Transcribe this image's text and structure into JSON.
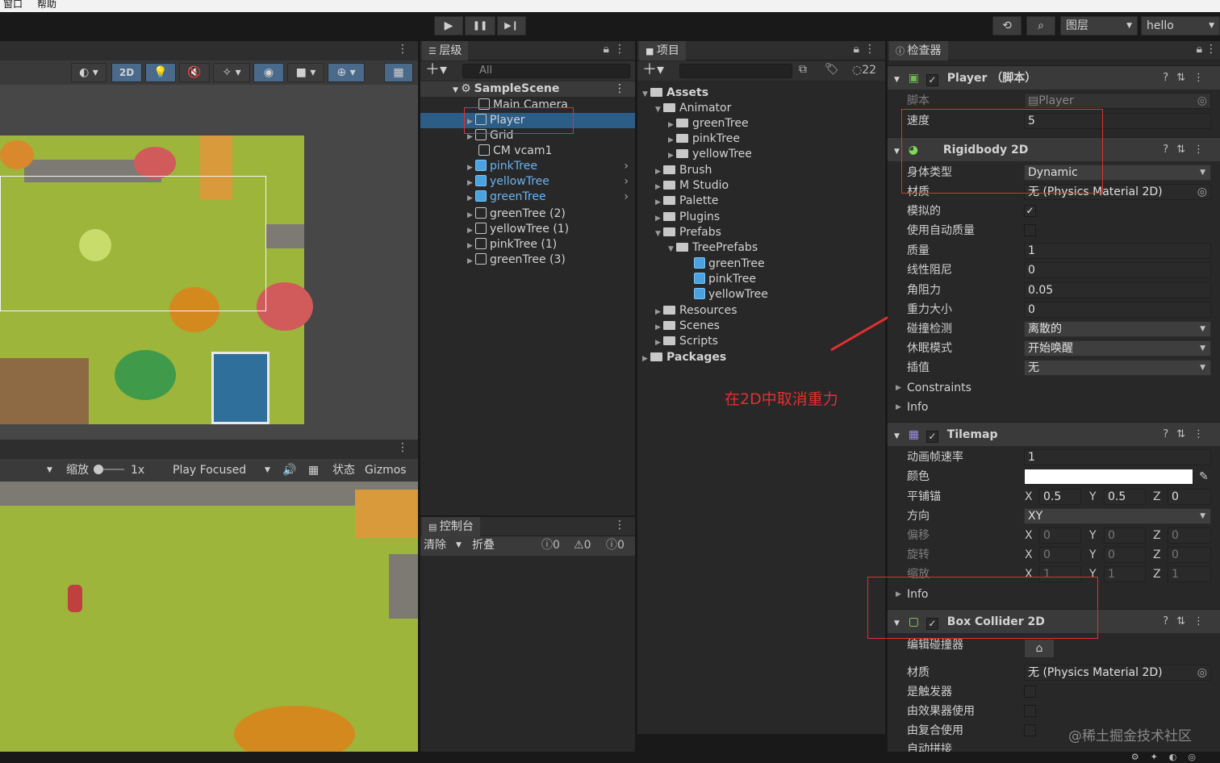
{
  "menubar": {
    "items": [
      "窗口",
      "帮助"
    ]
  },
  "toolbar": {
    "play": "▶",
    "pause": "❚❚",
    "step": "▶❙",
    "history": "⟲",
    "search": "⌕",
    "layers": "图层",
    "layout": "hello"
  },
  "scene": {
    "toggle_2d": "2D"
  },
  "game": {
    "scale_label": "缩放",
    "scale_value": "1x",
    "play_mode": "Play Focused",
    "stats": "状态",
    "gizmos": "Gizmos"
  },
  "hierarchy": {
    "tab": "层级",
    "search_placeholder": "All",
    "scene": "SampleScene",
    "items": [
      {
        "label": "Main Camera",
        "prefab": false
      },
      {
        "label": "Player",
        "prefab": false,
        "selected": true
      },
      {
        "label": "Grid",
        "prefab": false
      },
      {
        "label": "CM vcam1",
        "prefab": false
      },
      {
        "label": "pinkTree",
        "prefab": true
      },
      {
        "label": "yellowTree",
        "prefab": true
      },
      {
        "label": "greenTree",
        "prefab": true
      },
      {
        "label": "greenTree (2)",
        "prefab": false
      },
      {
        "label": "yellowTree (1)",
        "prefab": false
      },
      {
        "label": "pinkTree (1)",
        "prefab": false
      },
      {
        "label": "greenTree (3)",
        "prefab": false
      }
    ]
  },
  "console": {
    "tab": "控制台",
    "clear": "清除",
    "collapse": "折叠",
    "log_count": "0",
    "warn_count": "0",
    "error_count": "0"
  },
  "project": {
    "tab": "项目",
    "hidden_count": "22",
    "tree": [
      {
        "label": "Assets",
        "bold": true
      },
      {
        "label": "Animator"
      },
      {
        "label": "greenTree"
      },
      {
        "label": "pinkTree"
      },
      {
        "label": "yellowTree"
      },
      {
        "label": "Brush"
      },
      {
        "label": "M Studio"
      },
      {
        "label": "Palette"
      },
      {
        "label": "Plugins"
      },
      {
        "label": "Prefabs"
      },
      {
        "label": "TreePrefabs"
      },
      {
        "label": "greenTree"
      },
      {
        "label": "pinkTree"
      },
      {
        "label": "yellowTree"
      },
      {
        "label": "Resources"
      },
      {
        "label": "Scenes"
      },
      {
        "label": "Scripts"
      },
      {
        "label": "Packages",
        "bold": true
      }
    ]
  },
  "annotation": {
    "text": "在2D中取消重力"
  },
  "inspector": {
    "tab": "检查器",
    "player": {
      "title": "Player （脚本）",
      "script_label": "脚本",
      "script_value": "Player",
      "speed_label": "速度",
      "speed_value": "5"
    },
    "rigidbody": {
      "title": "Rigidbody 2D",
      "fields": [
        {
          "label": "身体类型",
          "value": "Dynamic",
          "type": "drop"
        },
        {
          "label": "材质",
          "value": "无 (Physics Material 2D)",
          "type": "obj"
        },
        {
          "label": "模拟的",
          "value": "✓",
          "type": "check"
        },
        {
          "label": "使用自动质量",
          "value": "",
          "type": "check"
        },
        {
          "label": "质量",
          "value": "1",
          "type": "text"
        },
        {
          "label": "线性阻尼",
          "value": "0",
          "type": "text"
        },
        {
          "label": "角阻力",
          "value": "0.05",
          "type": "text"
        },
        {
          "label": "重力大小",
          "value": "0",
          "type": "text"
        },
        {
          "label": "碰撞检测",
          "value": "离散的",
          "type": "drop"
        },
        {
          "label": "休眠模式",
          "value": "开始唤醒",
          "type": "drop"
        },
        {
          "label": "插值",
          "value": "无",
          "type": "drop"
        }
      ],
      "constraints": "Constraints",
      "info": "Info"
    },
    "tilemap": {
      "title": "Tilemap",
      "frame_rate_label": "动画帧速率",
      "frame_rate_value": "1",
      "color_label": "颜色",
      "anchor_label": "平铺锚",
      "anchor": {
        "x": "0.5",
        "y": "0.5",
        "z": "0"
      },
      "orientation_label": "方向",
      "orientation_value": "XY",
      "offset_label": "偏移",
      "offset": {
        "x": "0",
        "y": "0",
        "z": "0"
      },
      "rotation_label": "旋转",
      "rotation": {
        "x": "0",
        "y": "0",
        "z": "0"
      },
      "scale_label": "缩放",
      "scale": {
        "x": "1",
        "y": "1",
        "z": "1"
      },
      "info": "Info"
    },
    "box": {
      "title": "Box Collider 2D",
      "edit_label": "编辑碰撞器",
      "material_label": "材质",
      "material_value": "无 (Physics Material 2D)",
      "trigger_label": "是触发器",
      "effector_label": "由效果器使用",
      "composite_label": "由复合使用",
      "autotile_label": "自动拼接"
    }
  },
  "watermark": "@稀土掘金技术社区",
  "colors": {
    "accent": "#2c5d87",
    "red": "#e23030",
    "grass": "#9cb53a"
  }
}
